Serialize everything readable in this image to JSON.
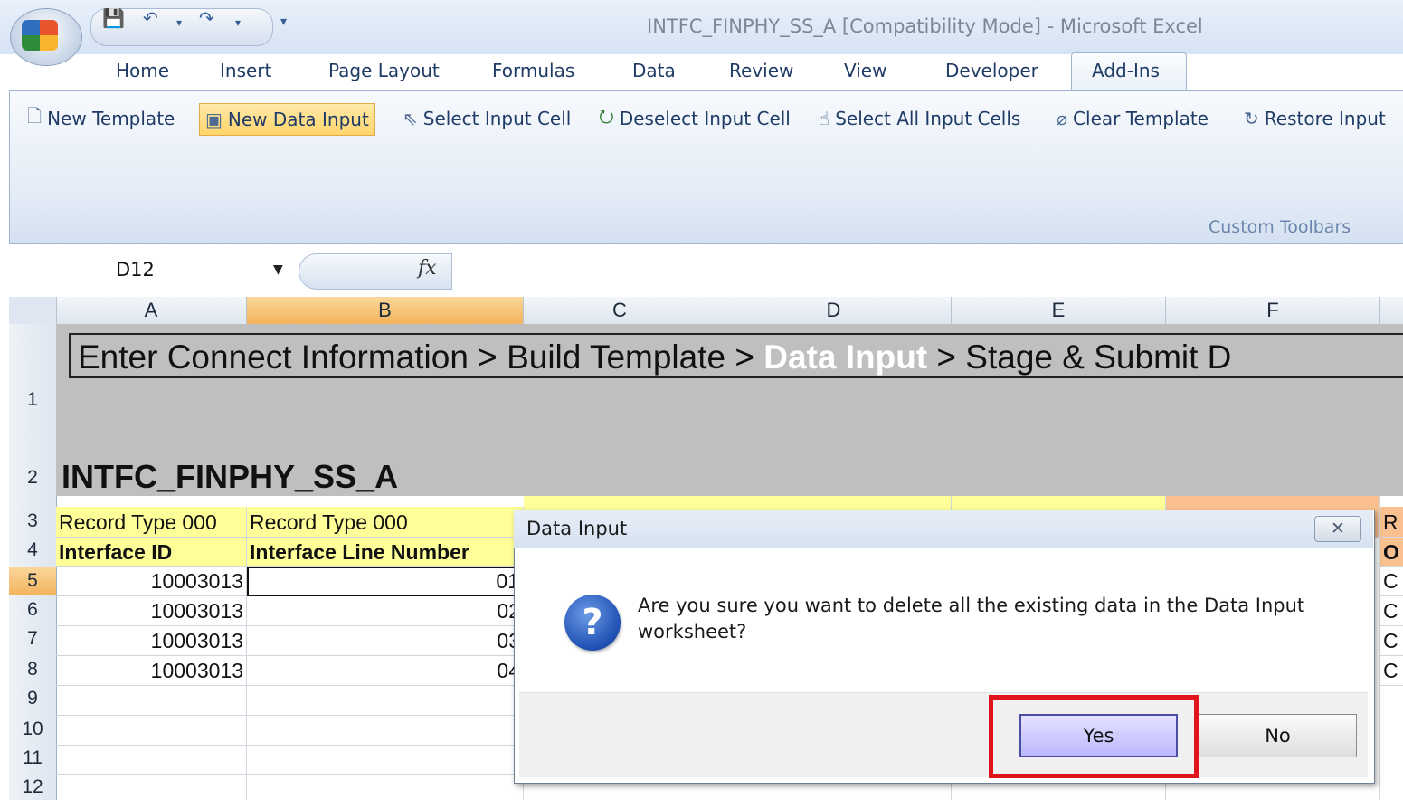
{
  "window": {
    "title": "INTFC_FINPHY_SS_A  [Compatibility Mode] - Microsoft Excel"
  },
  "tabs": [
    "Home",
    "Insert",
    "Page Layout",
    "Formulas",
    "Data",
    "Review",
    "View",
    "Developer",
    "Add-Ins"
  ],
  "active_tab": "Add-Ins",
  "ribbon": {
    "buttons": [
      "New Template",
      "New Data Input",
      "Select Input Cell",
      "Deselect Input Cell",
      "Select All Input Cells",
      "Clear Template",
      "Restore Input"
    ],
    "group_label": "Custom Toolbars"
  },
  "formula_bar": {
    "cell_ref": "D12",
    "fx": "fx",
    "value": ""
  },
  "columns": [
    "A",
    "B",
    "C",
    "D",
    "E",
    "F"
  ],
  "selected_column": "B",
  "rows": [
    "1",
    "2",
    "3",
    "4",
    "5",
    "6",
    "7",
    "8",
    "9",
    "10",
    "11",
    "12"
  ],
  "selected_row": "5",
  "sheet": {
    "wizard_pre": "Enter Connect Information > Build Template > ",
    "wizard_current": "Data Input",
    "wizard_post": " > Stage & Submit D",
    "title": "INTFC_FINPHY_SS_A",
    "row3": {
      "A": "Record Type 000",
      "B": "Record Type 000",
      "G": "R"
    },
    "row4": {
      "A": "Interface ID",
      "B": "Interface Line Number",
      "G": "O"
    },
    "data": [
      {
        "A": "10003013",
        "B": "01",
        "G": "C"
      },
      {
        "A": "10003013",
        "B": "02",
        "G": "C"
      },
      {
        "A": "10003013",
        "B": "03",
        "G": "C"
      },
      {
        "A": "10003013",
        "B": "04",
        "G": "C"
      }
    ]
  },
  "dialog": {
    "title": "Data Input",
    "close": "✕",
    "message": "Are you sure you want to delete all the existing data in the Data Input worksheet?",
    "yes": "Yes",
    "no": "No"
  },
  "colors": {
    "highlight": "#e0151b",
    "header_selected": "#f3b35c",
    "record_type_fill": "#ffff99"
  }
}
